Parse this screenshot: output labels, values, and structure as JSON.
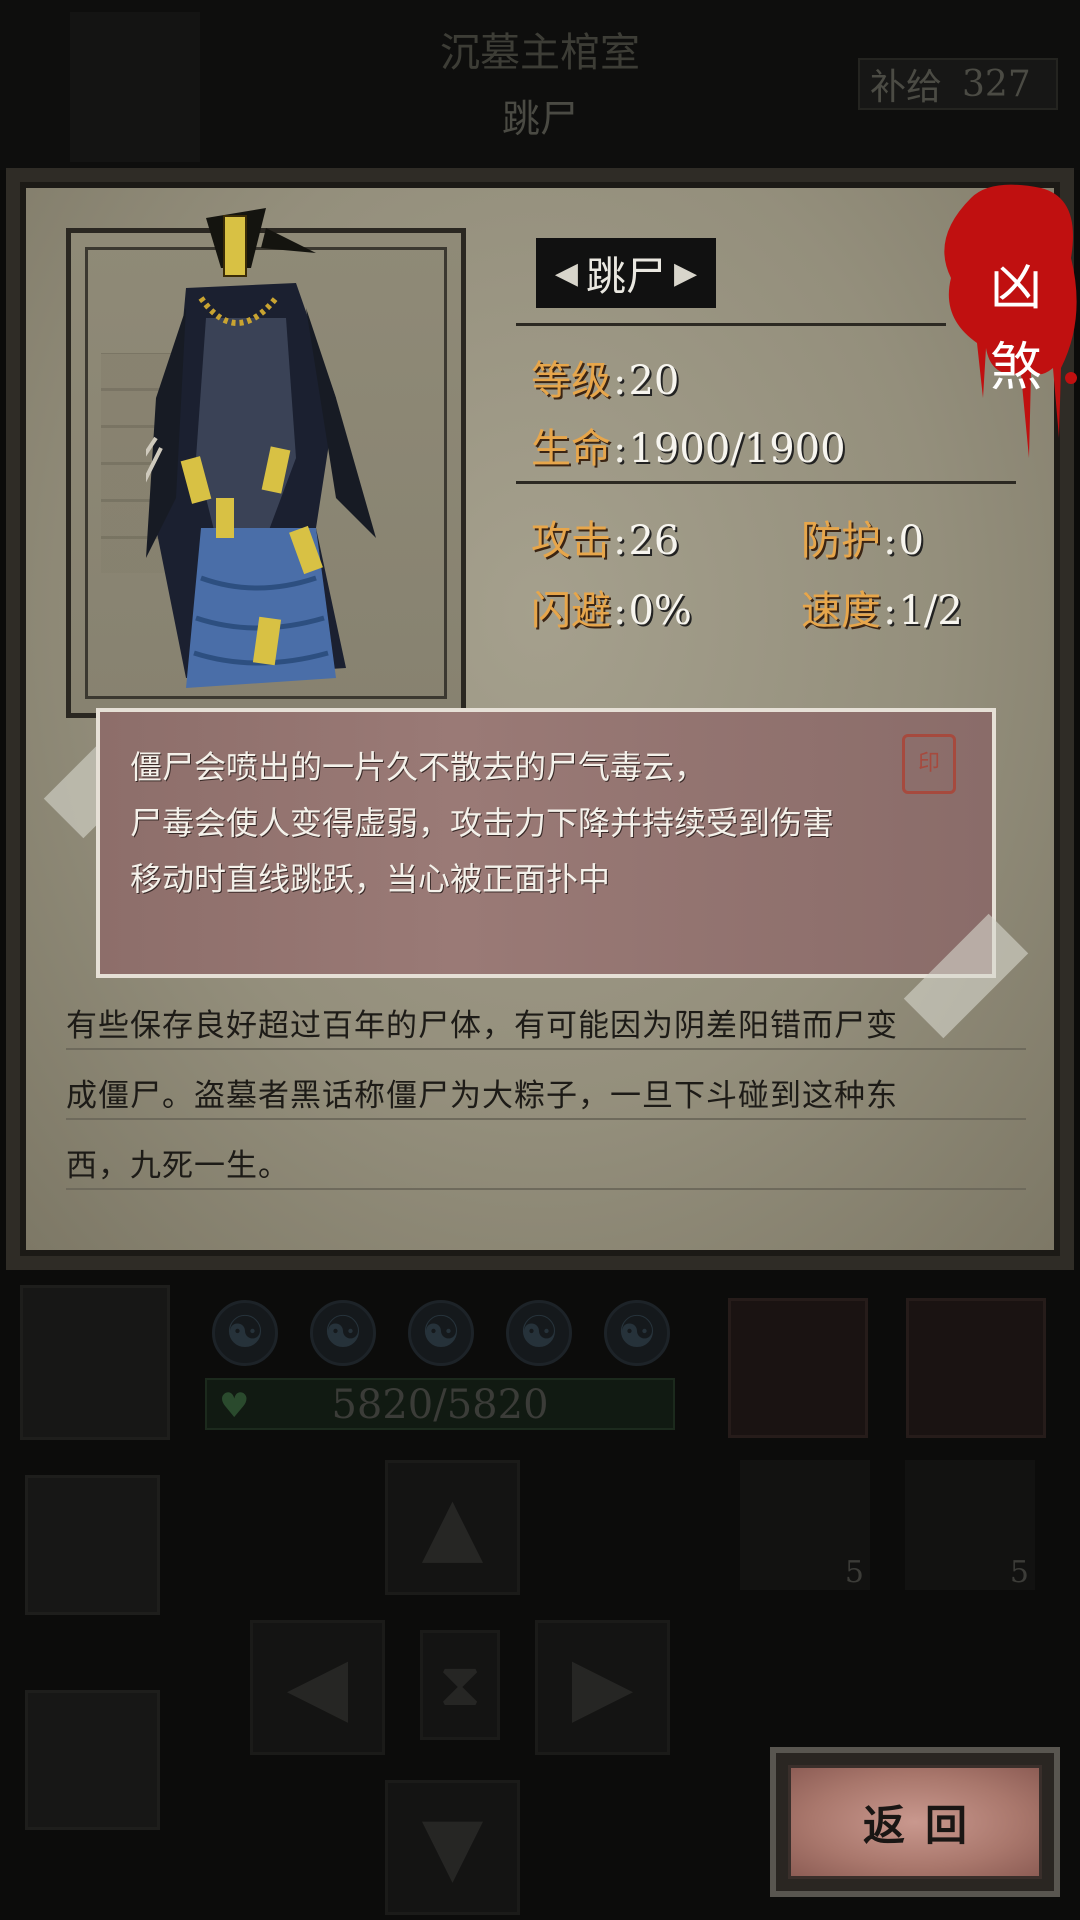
{
  "background": {
    "title_top": "沉墓主棺室",
    "subtitle": "跳尸",
    "supply_label": "补给",
    "supply_value": "327",
    "hp_text": "5820/5820",
    "item_counts": [
      "5",
      "5"
    ]
  },
  "dialog": {
    "monster_name": "跳尸",
    "rank": [
      "凶",
      "煞"
    ],
    "stats": {
      "level": {
        "label": "等级",
        "value": "20"
      },
      "hp": {
        "label": "生命",
        "value": "1900/1900"
      },
      "attack": {
        "label": "攻击",
        "value": "26"
      },
      "defense": {
        "label": "防护",
        "value": "0"
      },
      "dodge": {
        "label": "闪避",
        "value": "0%"
      },
      "speed": {
        "label": "速度",
        "value": "1/2"
      }
    },
    "ability_lines": [
      "僵尸会喷出的一片久不散去的尸气毒云，",
      "尸毒会使人变得虚弱，攻击力下降并持续受到伤害",
      "移动时直线跳跃，当心被正面扑中"
    ],
    "lore_lines": [
      "有些保存良好超过百年的尸体，有可能因为阴差阳错而尸变",
      "成僵尸。盗墓者黑话称僵尸为大粽子，一旦下斗碰到这种东",
      "西，九死一生。"
    ],
    "back_button": "返回"
  },
  "colors": {
    "stat_label": "#e7a64b",
    "blood": "#c01010",
    "paper": "#9c9784"
  }
}
